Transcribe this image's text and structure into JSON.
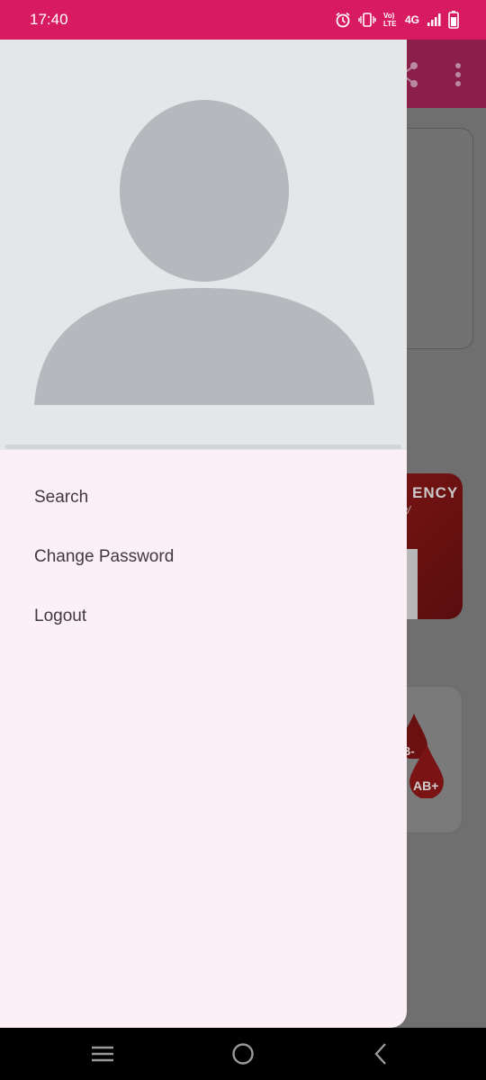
{
  "status_bar": {
    "time": "17:40",
    "network_label": "4G",
    "volte_label": "Vo) LTE",
    "icons": [
      "alarm-icon",
      "vibrate-icon",
      "volte-icon",
      "signal-icon",
      "battery-icon"
    ]
  },
  "background": {
    "emergency_card_text": "ENCY",
    "emergency_card_sub": "w/",
    "blood_group_label": "AB+",
    "blood_group_small": "B-"
  },
  "drawer": {
    "avatar_icon": "user-placeholder-icon",
    "menu": [
      {
        "label": "Search"
      },
      {
        "label": "Change Password"
      },
      {
        "label": "Logout"
      }
    ]
  },
  "nav_bar": {
    "icons": [
      "recent-apps-icon",
      "home-icon",
      "back-icon"
    ]
  },
  "colors": {
    "status_bar": "#d81b60",
    "app_bar": "#8a1f4a",
    "drawer_bg": "#fcf0f6",
    "header_bg": "#e5e6e8",
    "avatar": "#b5b9bd",
    "menu_text": "#3f3a40"
  }
}
